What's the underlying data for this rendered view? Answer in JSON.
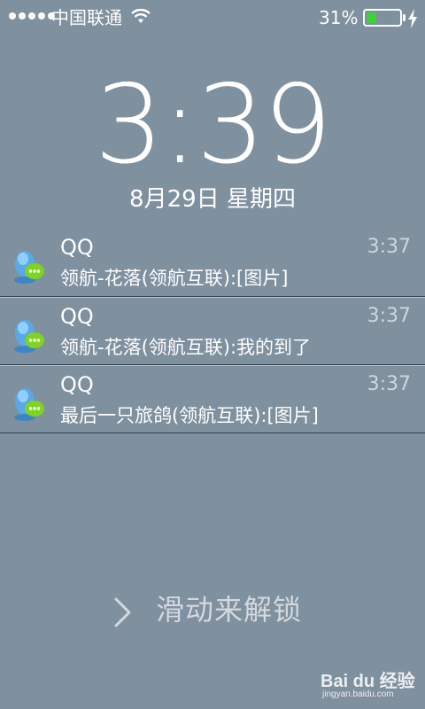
{
  "status_bar": {
    "signal_bars": 5,
    "carrier": "中国联通",
    "wifi_icon": "wifi-icon",
    "battery_percent": "31%",
    "battery_level": 0.31,
    "battery_color": "#3cd23c",
    "charging_icon": "lightning-bolt-icon"
  },
  "lock": {
    "time": "3:39",
    "date": "8月29日 星期四"
  },
  "notifications": [
    {
      "app": "QQ",
      "time": "3:37",
      "message": "领航-花落(领航互联):[图片]",
      "icon": "qq-message-icon"
    },
    {
      "app": "QQ",
      "time": "3:37",
      "message": "领航-花落(领航互联):我的到了",
      "icon": "qq-message-icon"
    },
    {
      "app": "QQ",
      "time": "3:37",
      "message": "最后一只旅鸽(领航互联):[图片]",
      "icon": "qq-message-icon"
    }
  ],
  "unlock": {
    "label": "滑动来解锁",
    "chevron_icon": "chevron-right-icon"
  },
  "watermark": {
    "brand": "Bai du 经验",
    "url": "jingyan.baidu.com"
  }
}
